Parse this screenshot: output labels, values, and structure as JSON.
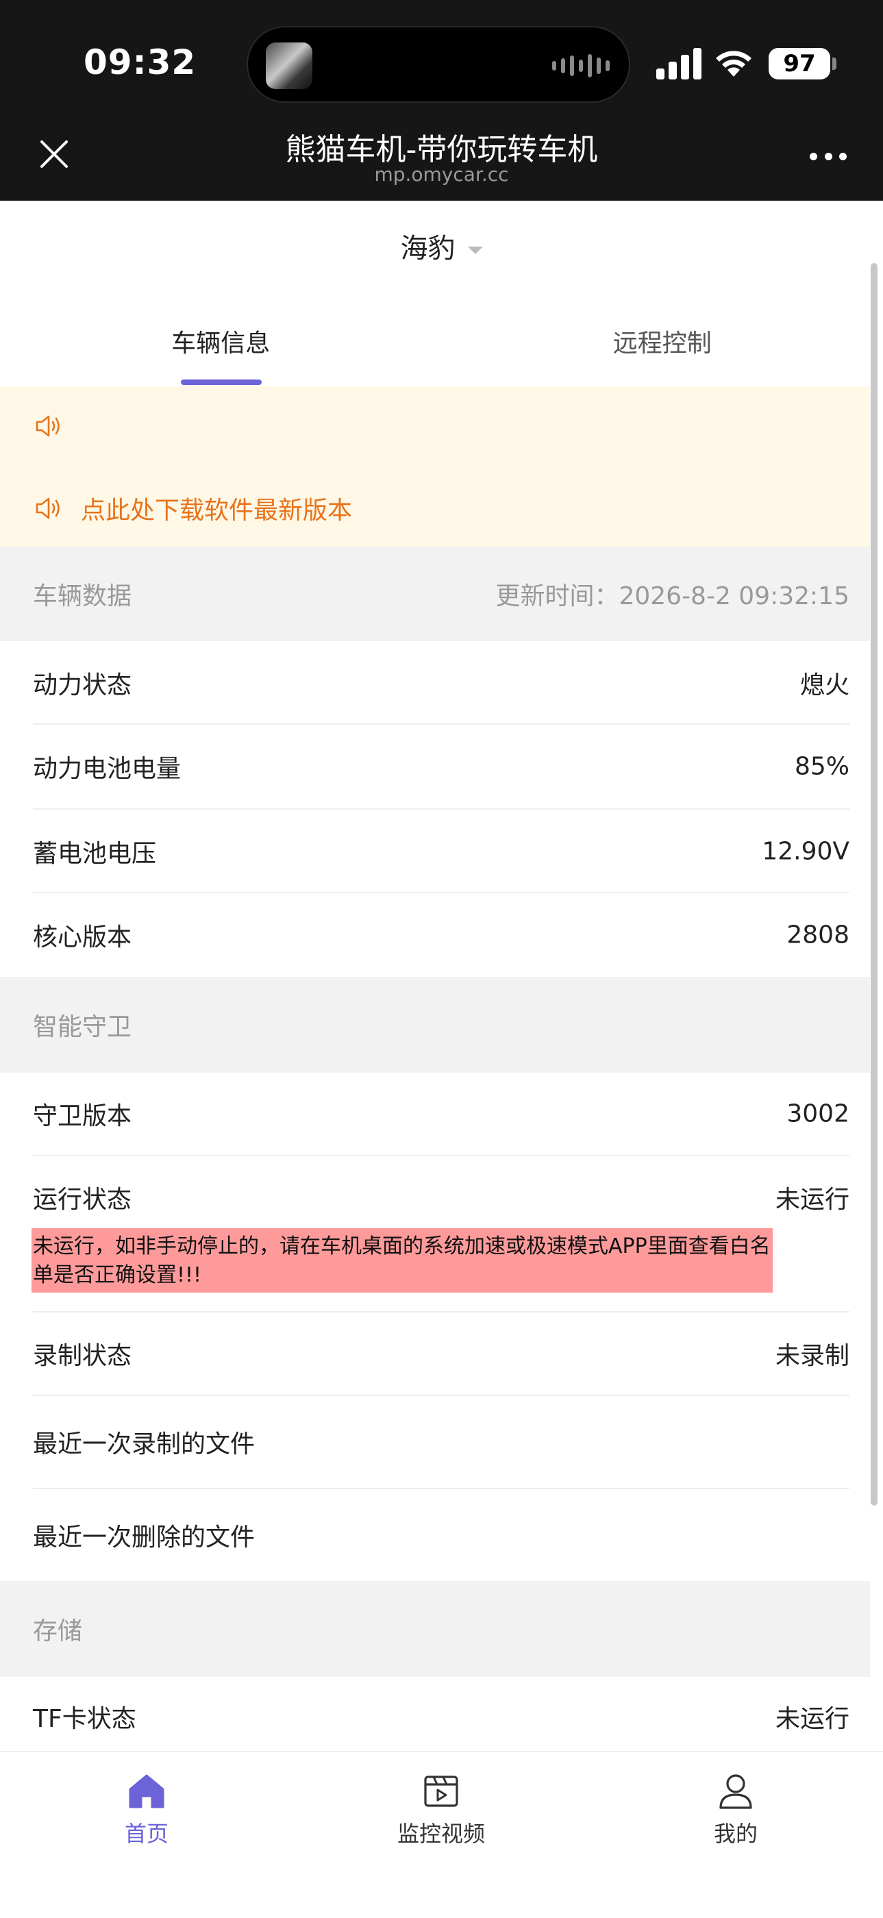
{
  "status_bar": {
    "time": "09:32",
    "battery": "97"
  },
  "header": {
    "title": "熊猫车机-带你玩转车机",
    "url": "mp.omycar.cc"
  },
  "vehicle_selector": {
    "value": "海豹"
  },
  "tabs": [
    {
      "label": "车辆信息",
      "active": true
    },
    {
      "label": "远程控制",
      "active": false
    }
  ],
  "notice": {
    "line1": "",
    "line2": "点此处下载软件最新版本"
  },
  "vehicle_data": {
    "header": "车辆数据",
    "update_time": "更新时间：2026-8-2 09:32:15",
    "rows": [
      {
        "label": "动力状态",
        "value": "熄火"
      },
      {
        "label": "动力电池电量",
        "value": "85%"
      },
      {
        "label": "蓄电池电压",
        "value": "12.90V"
      },
      {
        "label": "核心版本",
        "value": "2808"
      }
    ]
  },
  "smart_guard": {
    "header": "智能守卫",
    "rows": [
      {
        "label": "守卫版本",
        "value": "3002"
      },
      {
        "label": "运行状态",
        "value": "未运行"
      },
      {
        "label": "录制状态",
        "value": "未录制"
      },
      {
        "label": "最近一次录制的文件",
        "value": ""
      },
      {
        "label": "最近一次删除的文件",
        "value": ""
      }
    ],
    "warning": "未运行，如非手动停止的，请在车机桌面的系统加速或极速模式APP里面查看白名单是否正确设置!!!"
  },
  "storage": {
    "header": "存储",
    "rows": [
      {
        "label": "TF卡状态",
        "value": "未运行"
      }
    ]
  },
  "bottom_nav": [
    {
      "label": "首页",
      "icon": "home-icon",
      "active": true
    },
    {
      "label": "监控视频",
      "icon": "video-icon",
      "active": false
    },
    {
      "label": "我的",
      "icon": "person-icon",
      "active": false
    }
  ],
  "colors": {
    "accent": "#6c63d9",
    "notice_bg": "#fff8e6",
    "notice_text": "#e8741c",
    "warning_bg": "#ff9a9a",
    "section_bg": "#f2f2f2"
  }
}
